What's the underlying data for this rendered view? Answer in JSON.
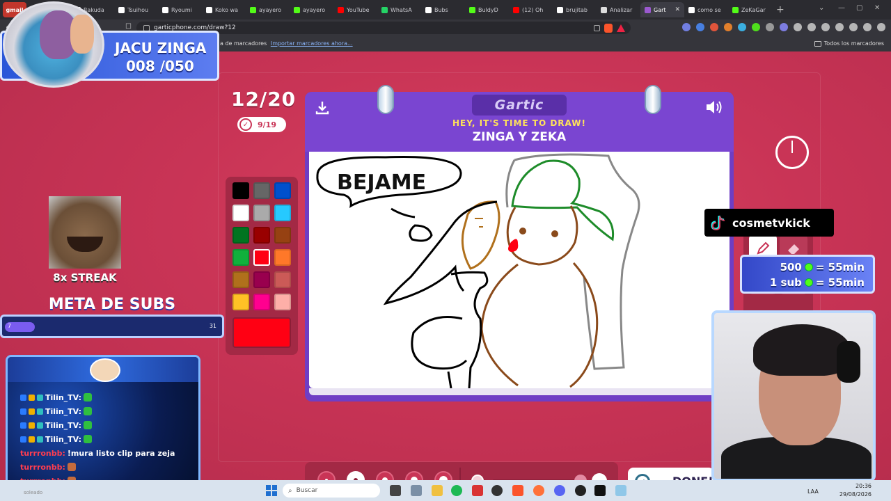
{
  "browser": {
    "tabs": [
      {
        "label": "gmail",
        "color": "#c2362c"
      },
      {
        "label": "",
        "color": "#ffffff"
      },
      {
        "label": "Rakuda",
        "color": "#ffffff"
      },
      {
        "label": "Tsuihou",
        "color": "#ffffff"
      },
      {
        "label": "Ryoumi",
        "color": "#ffffff"
      },
      {
        "label": "Koko wa",
        "color": "#ffffff"
      },
      {
        "label": "ayayero",
        "color": "#53fc18"
      },
      {
        "label": "ayayero",
        "color": "#53fc18"
      },
      {
        "label": "YouTube",
        "color": "#ff0000"
      },
      {
        "label": "WhatsA",
        "color": "#25d366"
      },
      {
        "label": "Bubs",
        "color": "#ffffff"
      },
      {
        "label": "BuldyD",
        "color": "#53fc18"
      },
      {
        "label": "(12) Oh",
        "color": "#ff0000"
      },
      {
        "label": "brujitab",
        "color": "#ffffff"
      },
      {
        "label": "Analizar",
        "color": "#dddddd"
      },
      {
        "label": "Gart",
        "color": "#9b59d0",
        "active": true
      },
      {
        "label": "como se",
        "color": "#ffffff"
      },
      {
        "label": "ZeKaGar",
        "color": "#53fc18"
      }
    ],
    "url": "garticphone.com/draw?12",
    "bookmarks_prefix": "a de marcadores",
    "bookmarks_link": "Importar marcadores ahora...",
    "bookmarks_all": "Todos los marcadores"
  },
  "game": {
    "round": "12/20",
    "score": "9/19",
    "logo": "Gartic",
    "prompt_header": "HEY, IT'S TIME TO DRAW!",
    "prompt": "ZINGA Y ZEKA",
    "drawing_text": "BEJAME",
    "done_label": "DONE!",
    "palette": [
      {
        "color": "#000000"
      },
      {
        "color": "#666666"
      },
      {
        "color": "#0050cd"
      },
      {
        "color": "#ffffff"
      },
      {
        "color": "#aaaaaa"
      },
      {
        "color": "#26c9ff"
      },
      {
        "color": "#017420"
      },
      {
        "color": "#990000"
      },
      {
        "color": "#964112"
      },
      {
        "color": "#11b03c"
      },
      {
        "color": "#ff0013",
        "selected": true
      },
      {
        "color": "#ff7829"
      },
      {
        "color": "#b0701c"
      },
      {
        "color": "#99004e"
      },
      {
        "color": "#cb5a57"
      },
      {
        "color": "#ffc126"
      },
      {
        "color": "#ff008f"
      },
      {
        "color": "#feafa8"
      }
    ],
    "current_color": "#ff0013",
    "brush_sizes": [
      1,
      2,
      3,
      4,
      5
    ],
    "selected_brush": 1,
    "tools": [
      {
        "name": "pen",
        "active": true
      },
      {
        "name": "eraser",
        "active": false
      }
    ]
  },
  "overlay": {
    "title_name": "JACU ZINGA",
    "title_count": "008 /050",
    "streak": "8x STREAK",
    "meta_title": "META DE SUBS",
    "meta_start": "7",
    "meta_end": "31",
    "meta_progress": 0.14,
    "chat": [
      {
        "user": "Tilin_TV:",
        "msg": "",
        "emote": "green",
        "red": false
      },
      {
        "user": "Tilin_TV:",
        "msg": "",
        "emote": "green",
        "red": false
      },
      {
        "user": "Tilin_TV:",
        "msg": "",
        "emote": "green",
        "red": false
      },
      {
        "user": "Tilin_TV:",
        "msg": "",
        "emote": "green",
        "red": false
      },
      {
        "user": "turrronbb:",
        "msg": "!mura listo clip para zeja",
        "emote": "",
        "red": true
      },
      {
        "user": "turrronbb:",
        "msg": "",
        "emote": "brown",
        "red": true
      },
      {
        "user": "turrronbb:",
        "msg": "",
        "emote": "brown",
        "red": true
      }
    ],
    "tiktok_handle": "cosmetvkick",
    "goal_1": "500",
    "goal_1_value": "= 55min",
    "goal_2": "1 sub",
    "goal_2_value": "= 55min"
  },
  "taskbar": {
    "search_placeholder": "Buscar",
    "lang": "LAA",
    "time": "20:36",
    "date": "29/08/2026",
    "corner": "soleado"
  }
}
